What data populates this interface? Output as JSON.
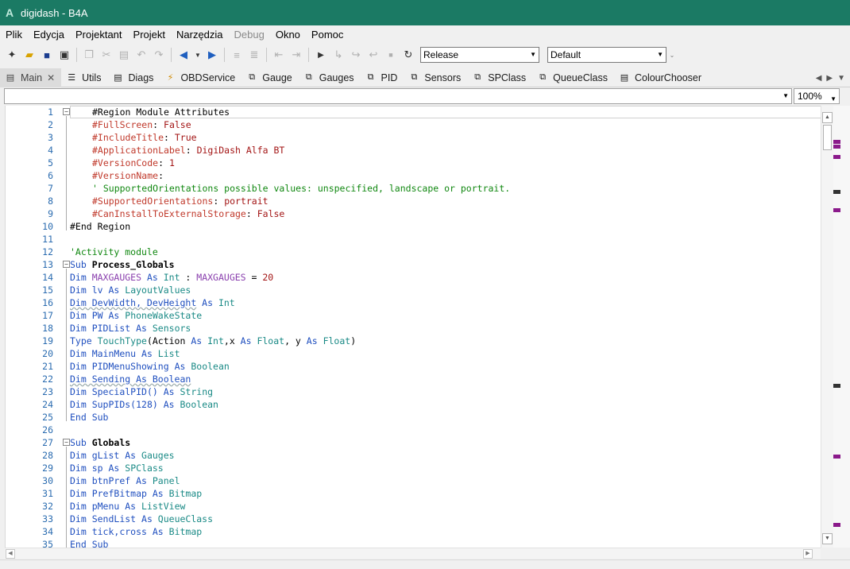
{
  "window": {
    "title": "digidash - B4A",
    "app_glyph": "A"
  },
  "menu": [
    {
      "label": "Plik",
      "enabled": true
    },
    {
      "label": "Edycja",
      "enabled": true
    },
    {
      "label": "Projektant",
      "enabled": true
    },
    {
      "label": "Projekt",
      "enabled": true
    },
    {
      "label": "Narzędzia",
      "enabled": true
    },
    {
      "label": "Debug",
      "enabled": false
    },
    {
      "label": "Okno",
      "enabled": true
    },
    {
      "label": "Pomoc",
      "enabled": true
    }
  ],
  "toolbar": {
    "build_config": "Release",
    "package_config": "Default",
    "icons": [
      "new-file-icon",
      "open-folder-icon",
      "save-icon",
      "save-all-icon",
      "copy-icon",
      "cut-icon",
      "paste-icon",
      "undo-icon",
      "redo-icon",
      "navigate-back-icon",
      "dropdown-icon",
      "navigate-forward-icon",
      "comment-icon",
      "uncomment-icon",
      "outdent-icon",
      "indent-icon",
      "run-icon",
      "step-into-icon",
      "step-over-icon",
      "step-out-icon",
      "stop-icon",
      "restart-icon"
    ]
  },
  "tabs": [
    {
      "label": "Main",
      "icon": "module-icon",
      "active": true
    },
    {
      "label": "Utils",
      "icon": "list-icon",
      "active": false
    },
    {
      "label": "Diags",
      "icon": "module-icon",
      "active": false
    },
    {
      "label": "OBDService",
      "icon": "service-icon",
      "active": false
    },
    {
      "label": "Gauge",
      "icon": "class-icon",
      "active": false
    },
    {
      "label": "Gauges",
      "icon": "class-icon",
      "active": false
    },
    {
      "label": "PID",
      "icon": "class-icon",
      "active": false
    },
    {
      "label": "Sensors",
      "icon": "class-icon",
      "active": false
    },
    {
      "label": "SPClass",
      "icon": "class-icon",
      "active": false
    },
    {
      "label": "QueueClass",
      "icon": "class-icon",
      "active": false
    },
    {
      "label": "ColourChooser",
      "icon": "module-icon",
      "active": false
    }
  ],
  "zoom": "100%",
  "colors": {
    "titlebar": "#1b7a64",
    "keyword": "#1f4fbf",
    "directive": "#c0392b",
    "type": "#1a8a86",
    "string": "#a31515",
    "comment": "#118811",
    "variable": "#8a3fae",
    "overview_mark": "#8b1a8b"
  },
  "code_lines": [
    {
      "n": "1",
      "fold": "-",
      "indent": 4,
      "tokens": [
        {
          "t": "#Region Module Attributes",
          "c": "plain"
        }
      ]
    },
    {
      "n": "2",
      "indent": 4,
      "tokens": [
        {
          "t": "#FullScreen",
          "c": "dir"
        },
        {
          "t": ": ",
          "c": "plain"
        },
        {
          "t": "False",
          "c": "str"
        }
      ]
    },
    {
      "n": "3",
      "indent": 4,
      "tokens": [
        {
          "t": "#IncludeTitle",
          "c": "dir"
        },
        {
          "t": ": ",
          "c": "plain"
        },
        {
          "t": "True",
          "c": "str"
        }
      ]
    },
    {
      "n": "4",
      "indent": 4,
      "tokens": [
        {
          "t": "#ApplicationLabel",
          "c": "dir"
        },
        {
          "t": ": ",
          "c": "plain"
        },
        {
          "t": "DigiDash Alfa BT",
          "c": "str"
        }
      ]
    },
    {
      "n": "5",
      "indent": 4,
      "tokens": [
        {
          "t": "#VersionCode",
          "c": "dir"
        },
        {
          "t": ": ",
          "c": "plain"
        },
        {
          "t": "1",
          "c": "str"
        }
      ]
    },
    {
      "n": "6",
      "indent": 4,
      "tokens": [
        {
          "t": "#VersionName",
          "c": "dir"
        },
        {
          "t": ":",
          "c": "plain"
        }
      ]
    },
    {
      "n": "7",
      "indent": 4,
      "tokens": [
        {
          "t": "' SupportedOrientations possible values: unspecified, landscape or portrait.",
          "c": "com"
        }
      ]
    },
    {
      "n": "8",
      "indent": 4,
      "tokens": [
        {
          "t": "#SupportedOrientations",
          "c": "dir"
        },
        {
          "t": ": ",
          "c": "plain"
        },
        {
          "t": "portrait",
          "c": "str"
        }
      ]
    },
    {
      "n": "9",
      "indent": 4,
      "tokens": [
        {
          "t": "#CanInstallToExternalStorage",
          "c": "dir"
        },
        {
          "t": ": ",
          "c": "plain"
        },
        {
          "t": "False",
          "c": "str"
        }
      ]
    },
    {
      "n": "10",
      "indent": 0,
      "tokens": [
        {
          "t": "#End Region",
          "c": "plain"
        }
      ]
    },
    {
      "n": "11",
      "indent": 0,
      "tokens": []
    },
    {
      "n": "12",
      "indent": 0,
      "tokens": [
        {
          "t": "'Activity module",
          "c": "com"
        }
      ]
    },
    {
      "n": "13",
      "fold": "-",
      "indent": 0,
      "tokens": [
        {
          "t": "Sub ",
          "c": "kw"
        },
        {
          "t": "Process_Globals",
          "c": "bold"
        }
      ]
    },
    {
      "n": "14",
      "indent": 0,
      "tokens": [
        {
          "t": "Dim ",
          "c": "kw"
        },
        {
          "t": "MAXGAUGES",
          "c": "var"
        },
        {
          "t": " As ",
          "c": "kw"
        },
        {
          "t": "Int",
          "c": "type"
        },
        {
          "t": " : ",
          "c": "plain"
        },
        {
          "t": "MAXGAUGES",
          "c": "var"
        },
        {
          "t": " = ",
          "c": "plain"
        },
        {
          "t": "20",
          "c": "num"
        }
      ]
    },
    {
      "n": "15",
      "indent": 0,
      "tokens": [
        {
          "t": "Dim ",
          "c": "kw"
        },
        {
          "t": "lv",
          "c": "kw"
        },
        {
          "t": " As ",
          "c": "kw"
        },
        {
          "t": "LayoutValues",
          "c": "type"
        }
      ]
    },
    {
      "n": "16",
      "indent": 0,
      "tokens": [
        {
          "t": "Dim DevWidth, DevHeight",
          "c": "und"
        },
        {
          "t": " As ",
          "c": "kw"
        },
        {
          "t": "Int",
          "c": "type"
        }
      ]
    },
    {
      "n": "17",
      "indent": 0,
      "tokens": [
        {
          "t": "Dim ",
          "c": "kw"
        },
        {
          "t": "PW",
          "c": "kw"
        },
        {
          "t": " As ",
          "c": "kw"
        },
        {
          "t": "PhoneWakeState",
          "c": "type"
        }
      ]
    },
    {
      "n": "18",
      "indent": 0,
      "tokens": [
        {
          "t": "Dim ",
          "c": "kw"
        },
        {
          "t": "PIDList",
          "c": "kw"
        },
        {
          "t": " As ",
          "c": "kw"
        },
        {
          "t": "Sensors",
          "c": "type"
        }
      ]
    },
    {
      "n": "19",
      "indent": 0,
      "tokens": [
        {
          "t": "Type ",
          "c": "kw"
        },
        {
          "t": "TouchType",
          "c": "type"
        },
        {
          "t": "(Action ",
          "c": "plain"
        },
        {
          "t": "As ",
          "c": "kw"
        },
        {
          "t": "Int",
          "c": "type"
        },
        {
          "t": ",x ",
          "c": "plain"
        },
        {
          "t": "As ",
          "c": "kw"
        },
        {
          "t": "Float",
          "c": "type"
        },
        {
          "t": ", y ",
          "c": "plain"
        },
        {
          "t": "As ",
          "c": "kw"
        },
        {
          "t": "Float",
          "c": "type"
        },
        {
          "t": ")",
          "c": "plain"
        }
      ]
    },
    {
      "n": "20",
      "indent": 0,
      "tokens": [
        {
          "t": "Dim ",
          "c": "kw"
        },
        {
          "t": "MainMenu",
          "c": "kw"
        },
        {
          "t": " As ",
          "c": "kw"
        },
        {
          "t": "List",
          "c": "type"
        }
      ]
    },
    {
      "n": "21",
      "indent": 0,
      "tokens": [
        {
          "t": "Dim ",
          "c": "kw"
        },
        {
          "t": "PIDMenuShowing",
          "c": "kw"
        },
        {
          "t": " As ",
          "c": "kw"
        },
        {
          "t": "Boolean",
          "c": "type"
        }
      ]
    },
    {
      "n": "22",
      "indent": 0,
      "tokens": [
        {
          "t": "Dim Sending As Boolean",
          "c": "und"
        }
      ]
    },
    {
      "n": "23",
      "indent": 0,
      "tokens": [
        {
          "t": "Dim ",
          "c": "kw"
        },
        {
          "t": "SpecialPID()",
          "c": "kw"
        },
        {
          "t": " As ",
          "c": "kw"
        },
        {
          "t": "String",
          "c": "type"
        }
      ]
    },
    {
      "n": "24",
      "indent": 0,
      "tokens": [
        {
          "t": "Dim ",
          "c": "kw"
        },
        {
          "t": "SupPIDs(128)",
          "c": "kw"
        },
        {
          "t": " As ",
          "c": "kw"
        },
        {
          "t": "Boolean",
          "c": "type"
        }
      ]
    },
    {
      "n": "25",
      "indent": 0,
      "tokens": [
        {
          "t": "End Sub",
          "c": "kw"
        }
      ]
    },
    {
      "n": "26",
      "indent": 0,
      "tokens": []
    },
    {
      "n": "27",
      "fold": "-",
      "indent": 0,
      "tokens": [
        {
          "t": "Sub ",
          "c": "kw"
        },
        {
          "t": "Globals",
          "c": "bold"
        }
      ]
    },
    {
      "n": "28",
      "indent": 0,
      "tokens": [
        {
          "t": "Dim ",
          "c": "kw"
        },
        {
          "t": "gList",
          "c": "kw"
        },
        {
          "t": " As ",
          "c": "kw"
        },
        {
          "t": "Gauges",
          "c": "type"
        }
      ]
    },
    {
      "n": "29",
      "indent": 0,
      "tokens": [
        {
          "t": "Dim ",
          "c": "kw"
        },
        {
          "t": "sp",
          "c": "kw"
        },
        {
          "t": " As ",
          "c": "kw"
        },
        {
          "t": "SPClass",
          "c": "type"
        }
      ]
    },
    {
      "n": "30",
      "indent": 0,
      "tokens": [
        {
          "t": "Dim ",
          "c": "kw"
        },
        {
          "t": "btnPref",
          "c": "kw"
        },
        {
          "t": " As ",
          "c": "kw"
        },
        {
          "t": "Panel",
          "c": "type"
        }
      ]
    },
    {
      "n": "31",
      "indent": 0,
      "tokens": [
        {
          "t": "Dim ",
          "c": "kw"
        },
        {
          "t": "PrefBitmap",
          "c": "kw"
        },
        {
          "t": " As ",
          "c": "kw"
        },
        {
          "t": "Bitmap",
          "c": "type"
        }
      ]
    },
    {
      "n": "32",
      "indent": 0,
      "tokens": [
        {
          "t": "Dim ",
          "c": "kw"
        },
        {
          "t": "pMenu",
          "c": "kw"
        },
        {
          "t": " As ",
          "c": "kw"
        },
        {
          "t": "ListView",
          "c": "type"
        }
      ]
    },
    {
      "n": "33",
      "indent": 0,
      "tokens": [
        {
          "t": "Dim ",
          "c": "kw"
        },
        {
          "t": "SendList",
          "c": "kw"
        },
        {
          "t": " As ",
          "c": "kw"
        },
        {
          "t": "QueueClass",
          "c": "type"
        }
      ]
    },
    {
      "n": "34",
      "indent": 0,
      "tokens": [
        {
          "t": "Dim ",
          "c": "kw"
        },
        {
          "t": "tick,cross",
          "c": "kw"
        },
        {
          "t": " As ",
          "c": "kw"
        },
        {
          "t": "Bitmap",
          "c": "type"
        }
      ]
    },
    {
      "n": "35",
      "indent": 0,
      "tokens": [
        {
          "t": "End Sub",
          "c": "kw"
        }
      ]
    }
  ]
}
